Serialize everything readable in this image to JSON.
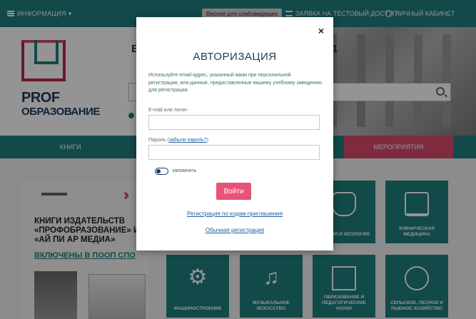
{
  "topbar": {
    "info_menu": "ИНФОРМАЦИЯ ▾",
    "impaired_version": "Версия для слабовидящих",
    "trial_access": "ЗАЯВКА НА ТЕСТОВЫЙ ДОСТУП",
    "cabinet": "ЛИЧНЫЙ КАБИНЕТ"
  },
  "logo": {
    "line1": "PROF",
    "line2": "ОБРАЗОВАНИЕ"
  },
  "hero": {
    "peek_left": "Б",
    "peek_right": "1"
  },
  "nav": {
    "books": "КНИГИ",
    "events": "МЕРОПРИЯТИЯ"
  },
  "promo": {
    "headline": "КНИГИ ИЗДАТЕЛЬСТВ «ПРОФОБРАЗОВАНИЕ» И «АЙ ПИ АР МЕДИА»",
    "included": "ВКЛЮЧЕНЫ В ПООП СПО"
  },
  "tiles": {
    "history": "СТОРИЯ И ХЕОЛОГИЯ",
    "medicine": "КЛИНИЧЕСКАЯ МЕДИЦИНА",
    "machinery": "МАШИНОСТРОЕНИЕ",
    "music": "МУЗЫКАЛЬНОЕ ИСКУССТВО",
    "education": "ОБРАЗОВАНИЕ И ПЕДАГОГИЧЕСКИЕ НАУКИ",
    "agriculture": "СЕЛЬСКОЕ, ЛЕСНОЕ И РЫБНОЕ ХОЗЯЙСТВО"
  },
  "modal": {
    "close_glyph": "×",
    "title": "АВТОРИЗАЦИЯ",
    "intro": "Используйте email-адрес, указанный вами при персональной регистрации, или данные, предоставленные вашему учебному заведению для регистрации.",
    "login_label": "E-mail или логин",
    "login_value": "",
    "password_label": "Пароль",
    "forgot_link": "забыли пароль?",
    "password_value": "",
    "remember_label": "запомнить",
    "submit_label": "Войти",
    "invite_link": "Регистрация по кодам приглашения",
    "regular_link": "Обычная регистрация"
  },
  "colors": {
    "teal": "#1f7f7f",
    "pink": "#e8537a",
    "navy": "#1d3b5a",
    "link": "#1f5f9f"
  },
  "icons": {
    "close": "close-icon",
    "toggle": "toggle-switch-icon"
  }
}
